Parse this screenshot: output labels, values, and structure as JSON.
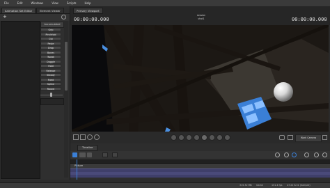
{
  "menu": [
    "File",
    "Edit",
    "Windows",
    "View",
    "Scripts",
    "Help"
  ],
  "left": {
    "tabs": [
      "Animation Set Editor",
      "Element Viewer"
    ],
    "add_label": "+",
    "header_label": "Accumulated",
    "buttons": [
      "Grip",
      "Pinchfold",
      "Cut",
      "Paste",
      "Drop",
      "Bones",
      "Tweak",
      "Doggle",
      "Hold",
      "Release",
      "Steady",
      "Fixed",
      "Spline",
      "Round"
    ],
    "slider_value": "0.5"
  },
  "viewport": {
    "tab": "Primary Viewport",
    "timecode_left": "00:00:00.000",
    "timecode_right": "00:00:00.000",
    "session_name": "session",
    "shot_name": "shot1"
  },
  "transport": {
    "camera_button": "Work Camera"
  },
  "timeline": {
    "tab": "Timeline",
    "track_label": "Picture"
  },
  "status": {
    "mem": "315.32 MB",
    "game": "Game",
    "fps": "151.4 fps",
    "rate": "47.22 K-31 (Sample)"
  },
  "colors": {
    "accent": "#3a7fd6",
    "track": "#4a4a7a"
  }
}
